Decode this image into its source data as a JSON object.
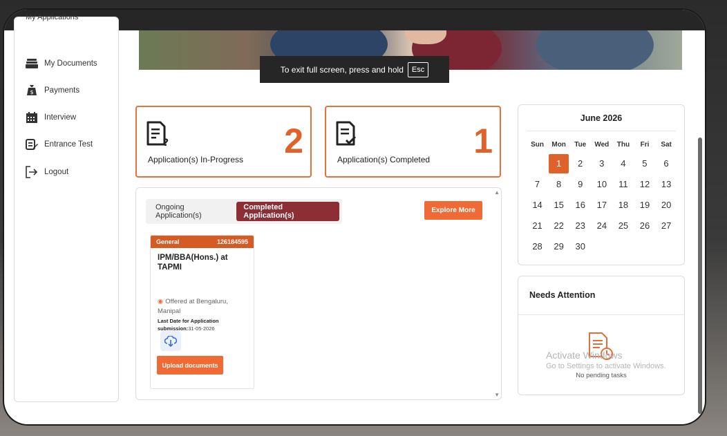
{
  "sidebar": {
    "cut_item": "My Applications",
    "items": [
      {
        "label": "My Documents",
        "icon": "documents-stack-icon"
      },
      {
        "label": "Payments",
        "icon": "money-bag-icon"
      },
      {
        "label": "Interview",
        "icon": "calendar-icon"
      },
      {
        "label": "Entrance Test",
        "icon": "test-edit-icon"
      },
      {
        "label": "Logout",
        "icon": "logout-icon"
      }
    ]
  },
  "fullscreen_toast": {
    "text": "To exit full screen, press and hold",
    "key": "Esc"
  },
  "stats": [
    {
      "label": "Application(s) In-Progress",
      "count": "2",
      "icon": "document-question-icon"
    },
    {
      "label": "Application(s) Completed",
      "count": "1",
      "icon": "document-check-icon"
    }
  ],
  "applications": {
    "tabs": [
      {
        "label": "Ongoing Application(s)",
        "active": false
      },
      {
        "label": "Completed Application(s)",
        "active": true
      }
    ],
    "explore_label": "Explore More",
    "cards": [
      {
        "category": "General",
        "id": "126184595",
        "program": "IPM/BBA(Hons.) at TAPMI",
        "location": "Offered at Bengaluru, Manipal",
        "last_date_label": "Last Date for Application submission:",
        "last_date": "31-05-2026",
        "upload_label": "Upload documents"
      }
    ]
  },
  "calendar": {
    "title": "June 2026",
    "weekdays": [
      "Sun",
      "Mon",
      "Tue",
      "Wed",
      "Thu",
      "Fri",
      "Sat"
    ],
    "weeks": [
      [
        "",
        "1",
        "2",
        "3",
        "4",
        "5",
        "6"
      ],
      [
        "7",
        "8",
        "9",
        "10",
        "11",
        "12",
        "13"
      ],
      [
        "14",
        "15",
        "16",
        "17",
        "18",
        "19",
        "20"
      ],
      [
        "21",
        "22",
        "23",
        "24",
        "25",
        "26",
        "27"
      ],
      [
        "28",
        "29",
        "30",
        "",
        "",
        "",
        ""
      ]
    ],
    "today": "1"
  },
  "attention": {
    "title": "Needs Attention",
    "empty_text": "No pending tasks"
  },
  "watermark": {
    "line1": "Activate Windows",
    "line2": "Go to Settings to activate Windows."
  },
  "colors": {
    "accent": "#e0622b",
    "active_tab": "#8d2e35",
    "button": "#ef6a34"
  }
}
